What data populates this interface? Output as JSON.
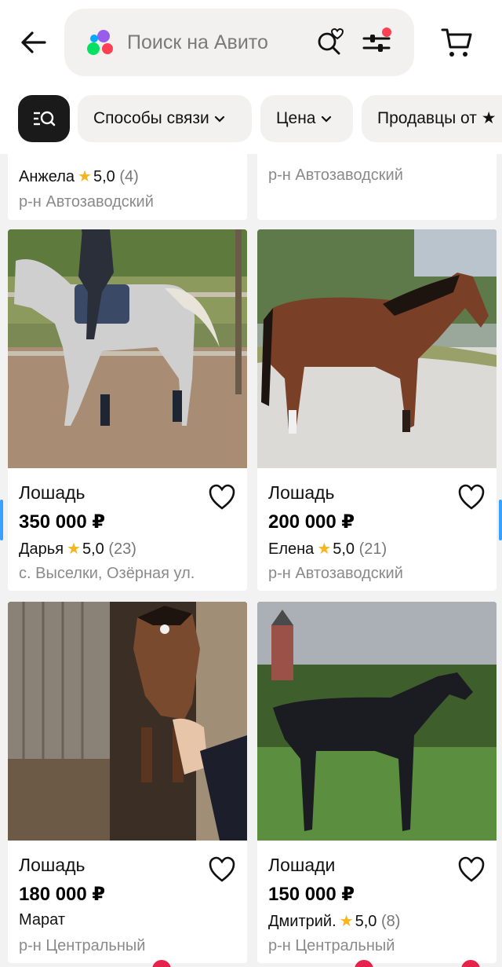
{
  "header": {
    "search_placeholder": "Поиск на Авито"
  },
  "chips": [
    {
      "label": "Способы связи"
    },
    {
      "label": "Цена"
    },
    {
      "label": "Продавцы от ★"
    }
  ],
  "listings": [
    {
      "seller": "Анжела",
      "rating": "5,0",
      "reviews": "(4)",
      "location": "р-н Автозаводский"
    },
    {
      "location": "р-н Автозаводский"
    },
    {
      "title": "Лошадь",
      "price": "350 000 ₽",
      "seller": "Дарья",
      "rating": "5,0",
      "reviews": "(23)",
      "location": "с. Выселки, Озёрная ул."
    },
    {
      "title": "Лошадь",
      "price": "200 000 ₽",
      "seller": "Елена",
      "rating": "5,0",
      "reviews": "(21)",
      "location": "р-н Автозаводский"
    },
    {
      "title": "Лошадь",
      "price": "180 000 ₽",
      "seller": "Марат",
      "location": "р-н Центральный"
    },
    {
      "title": "Лошади",
      "price": "150 000 ₽",
      "seller": "Дмитрий.",
      "rating": "5,0",
      "reviews": "(8)",
      "location": "р-н Центральный"
    }
  ],
  "colors": {
    "star": "#f6b51e",
    "accent_red": "#e6234b",
    "chip_bg": "#f2f1f0"
  }
}
